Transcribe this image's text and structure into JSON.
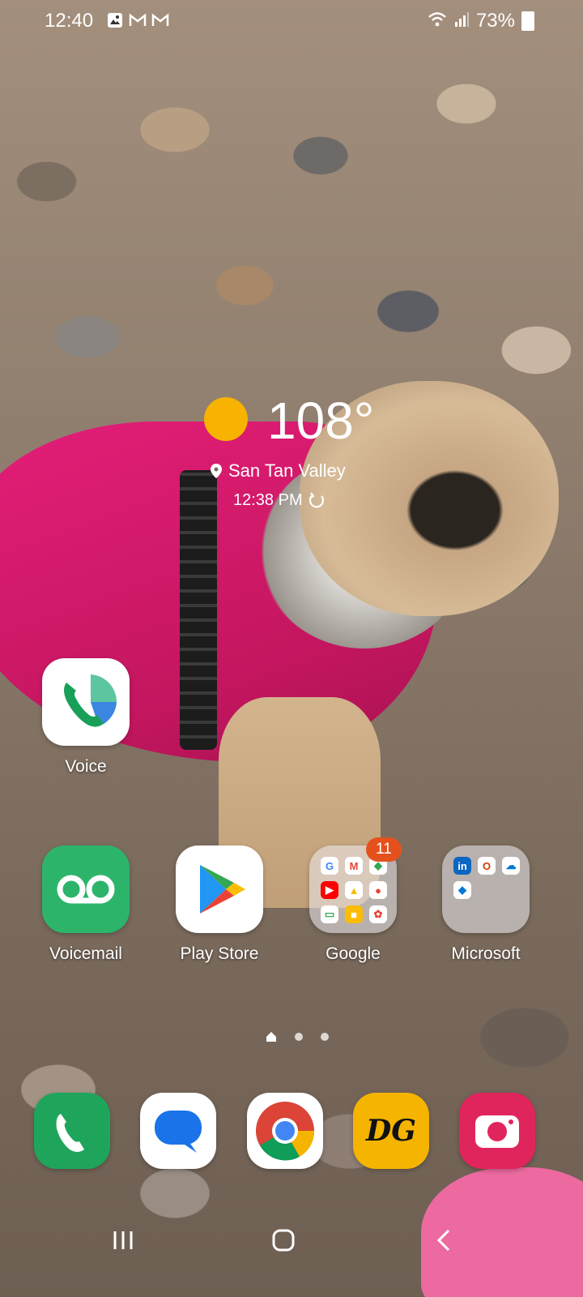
{
  "status_bar": {
    "time": "12:40",
    "battery": "73%",
    "left_icons": [
      "gallery-icon",
      "gmail-icon",
      "gmail-icon"
    ],
    "right_icons": [
      "wifi-icon",
      "signal-icon",
      "battery-icon"
    ]
  },
  "weather": {
    "temperature": "108°",
    "location": "San Tan Valley",
    "updated_time": "12:38 PM",
    "condition_icon": "sun-icon",
    "colors": {
      "sun": "#f7b300"
    }
  },
  "apps": [
    {
      "label": "Voice",
      "icon": "voice-app-icon"
    },
    {
      "label": "Voicemail",
      "icon": "voicemail-icon"
    },
    {
      "label": "Play Store",
      "icon": "play-store-icon"
    },
    {
      "label": "Google",
      "icon": "google-folder-icon",
      "badge": "11"
    },
    {
      "label": "Microsoft",
      "icon": "microsoft-folder-icon"
    }
  ],
  "google_folder_letters": [
    "G",
    "M",
    "◆",
    "▶",
    "▲",
    "●",
    "▭",
    "■",
    "✿"
  ],
  "microsoft_folder_letters": [
    "in",
    "O",
    "☁",
    "◆"
  ],
  "dock": [
    {
      "name": "phone",
      "icon": "phone-icon",
      "color": "#1fa55b"
    },
    {
      "name": "messages",
      "icon": "messages-icon",
      "color": "#ffffff"
    },
    {
      "name": "chrome",
      "icon": "chrome-icon",
      "color": "#ffffff"
    },
    {
      "name": "dollar-general",
      "icon": "dg-icon",
      "color": "#f5b400"
    },
    {
      "name": "camera",
      "icon": "camera-icon",
      "color": "#e0255d"
    }
  ],
  "dock_dg_text": "DG",
  "navigation": [
    "recents-button",
    "home-button",
    "back-button"
  ]
}
